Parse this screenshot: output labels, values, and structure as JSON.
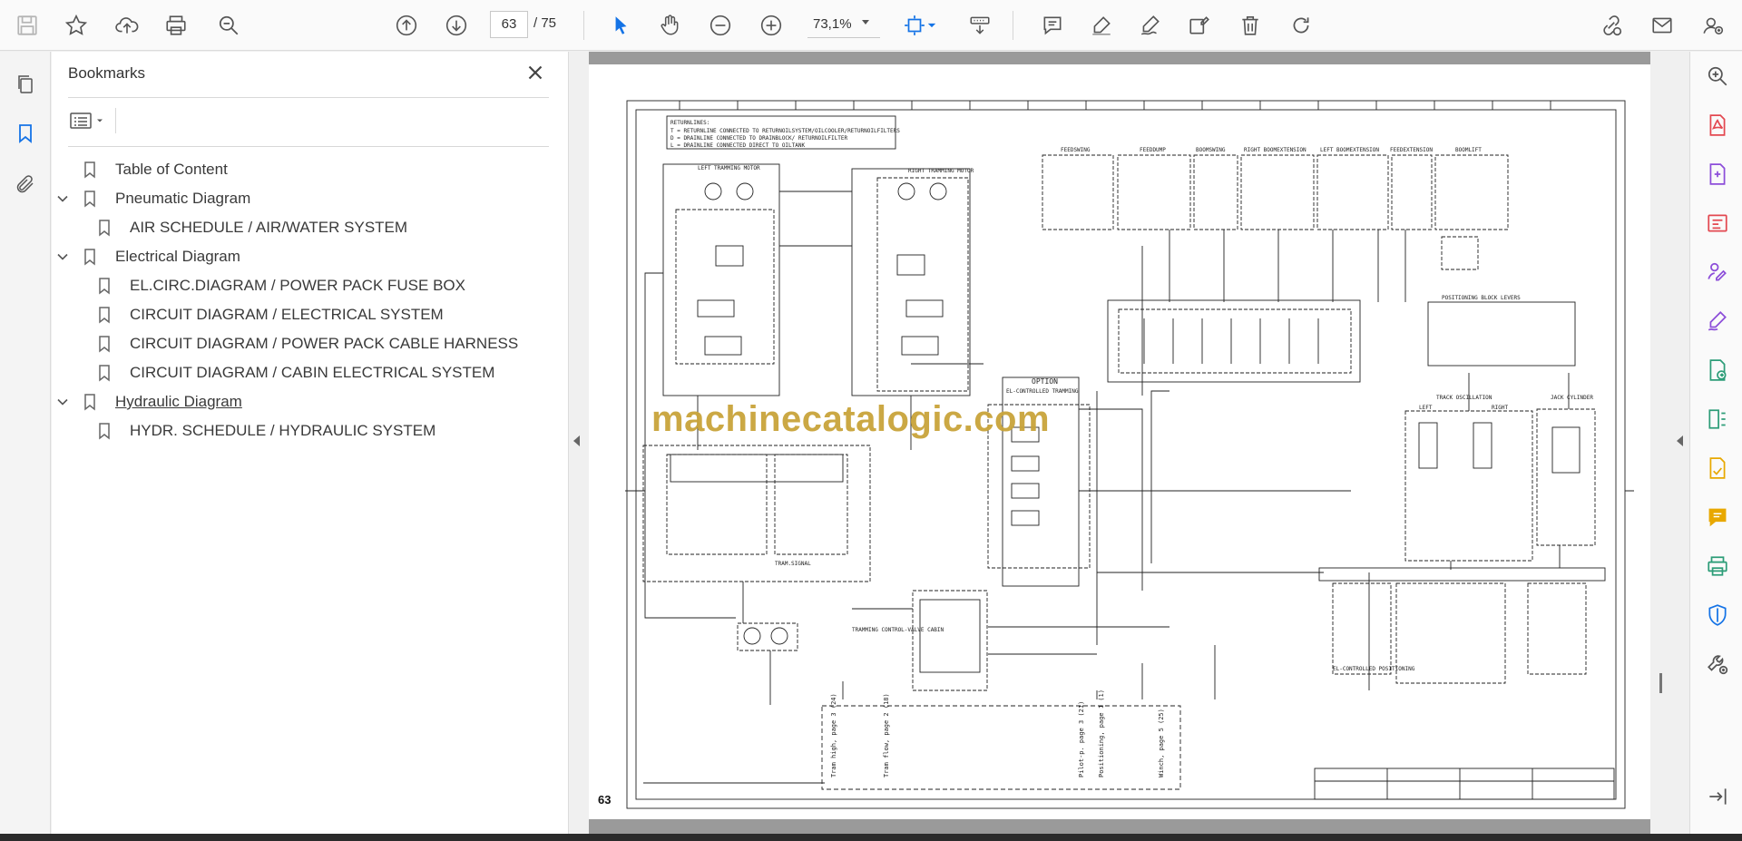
{
  "toolbar": {
    "icons": [
      "save-icon",
      "bookmark-star-icon",
      "upload-icon",
      "print-icon",
      "zoom-search-icon",
      "prev-page-icon",
      "next-page-icon",
      "select-cursor-icon",
      "hand-icon",
      "zoom-out-icon",
      "zoom-in-icon",
      "fit-page-icon",
      "scroll-mode-icon",
      "comment-icon",
      "highlight-icon",
      "draw-icon",
      "fill-sign-icon",
      "delete-icon",
      "rotate-icon",
      "share-link-icon",
      "email-icon",
      "account-icon"
    ],
    "current_page": "63",
    "total_pages": "/ 75",
    "zoom": "73,1%"
  },
  "bookmarks": {
    "title": "Bookmarks",
    "items": [
      {
        "label": "Table of Content",
        "level": 0,
        "expandable": false
      },
      {
        "label": "Pneumatic Diagram",
        "level": 0,
        "expandable": true
      },
      {
        "label": "AIR SCHEDULE / AIR/WATER SYSTEM",
        "level": 1,
        "expandable": false
      },
      {
        "label": "Electrical Diagram",
        "level": 0,
        "expandable": true
      },
      {
        "label": "EL.CIRC.DIAGRAM / POWER PACK FUSE BOX",
        "level": 1,
        "expandable": false
      },
      {
        "label": "CIRCUIT DIAGRAM / ELECTRICAL SYSTEM",
        "level": 1,
        "expandable": false
      },
      {
        "label": "CIRCUIT DIAGRAM / POWER PACK CABLE HARNESS",
        "level": 1,
        "expandable": false
      },
      {
        "label": "CIRCUIT DIAGRAM / CABIN ELECTRICAL SYSTEM",
        "level": 1,
        "expandable": false
      },
      {
        "label": "Hydraulic Diagram",
        "level": 0,
        "expandable": true
      },
      {
        "label": "HYDR. SCHEDULE / HYDRAULIC SYSTEM",
        "level": 1,
        "expandable": false
      }
    ]
  },
  "document": {
    "page_label": "63",
    "watermark": "machinecatalogic.com",
    "diagram_labels": {
      "returnlines": "RETURNLINES:",
      "r1": "T = RETURNLINE CONNECTED TO RETURNOILSYSTEM/OILCOOLER/RETURNOILFILTERS",
      "r2": "D = DRAINLINE CONNECTED TO DRAINBLOCK/ RETURNOILFILTER",
      "r3": "L = DRAINLINE CONNECTED DIRECT TO OILTANK",
      "left_motor": "LEFT TRAMMING MOTOR",
      "right_motor": "RIGHT TRAMMING MOTOR",
      "feedswing": "FEEDSWING",
      "feeddump": "FEEDDUMP",
      "boomswing": "BOOMSWING",
      "right_boomext": "RIGHT BOOMEXTENSION",
      "left_boomext": "LEFT BOOMEXTENSION",
      "feedext": "FEEDEXTENSION",
      "boomlift": "BOOMLIFT",
      "option": "OPTION",
      "el_tramming": "EL-CONTROLLED TRAMMING",
      "pos_levers": "POSITIONING BLOCK LEVERS",
      "track_osc": "TRACK OSCILLATION",
      "jack": "JACK CYLINDER",
      "tram_signal": "TRAM.SIGNAL",
      "tram_valve": "TRAMMING CONTROL-VALVE CABIN",
      "el_positioning": "EL-CONTROLLED POSITIONING",
      "left": "LEFT",
      "right": "RIGHT",
      "tram_high": "Tram high, page 3 (24)",
      "tram_flow": "Tram flow, page 2 (18)",
      "pilot": "Pilot-p. page 3 (21)",
      "positioning": "Positioning, page 1 (1)",
      "winch": "Winch, page 5 (25)"
    }
  },
  "right_tools": [
    "search-zoom-icon",
    "export-pdf-icon",
    "create-pdf-icon",
    "edit-pdf-icon",
    "request-esign-icon",
    "fill-sign-icon",
    "send-icon",
    "organize-pages-icon",
    "export-icon",
    "comment-tool-icon",
    "print-production-icon",
    "protect-icon",
    "more-tools-icon",
    "collapse-panel-icon"
  ],
  "colors": {
    "accent": "#1473e6",
    "red_tool": "#e34850",
    "purple_tool": "#8c4dd9",
    "green_tool": "#2d9d78",
    "yellow_tool": "#e8a800",
    "watermark": "#c9a43a"
  }
}
